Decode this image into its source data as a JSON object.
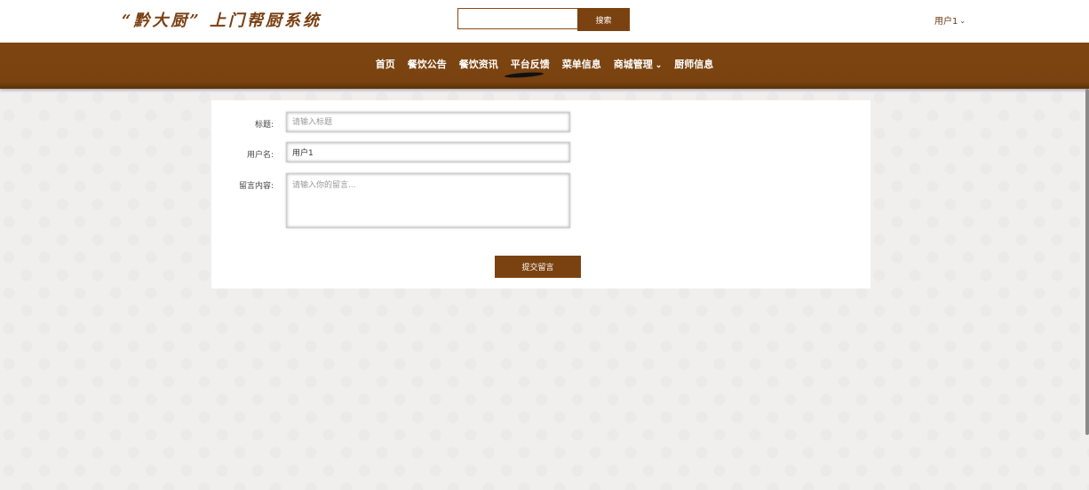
{
  "header": {
    "site_title": "“黔大厨” 上门帮厨系统",
    "search_placeholder": "",
    "search_button": "搜索",
    "user_label": "用户1",
    "user_chevron": "⌄"
  },
  "nav": {
    "items": [
      {
        "label": "首页"
      },
      {
        "label": "餐饮公告"
      },
      {
        "label": "餐饮资讯"
      },
      {
        "label": "平台反馈",
        "active": true
      },
      {
        "label": "菜单信息"
      },
      {
        "label": "商城管理",
        "has_dropdown": true
      },
      {
        "label": "厨师信息"
      }
    ],
    "dropdown_chevron": "⌄"
  },
  "form": {
    "title_label": "标题:",
    "title_placeholder": "请输入标题",
    "title_value": "",
    "username_label": "用户名:",
    "username_value": "用户1",
    "content_label": "留言内容:",
    "content_placeholder": "请输入你的留言...",
    "submit_button": "提交留言"
  },
  "colors": {
    "brand_brown": "#7b4211",
    "title_brown": "#7a3f12",
    "background": "#f0efee"
  }
}
